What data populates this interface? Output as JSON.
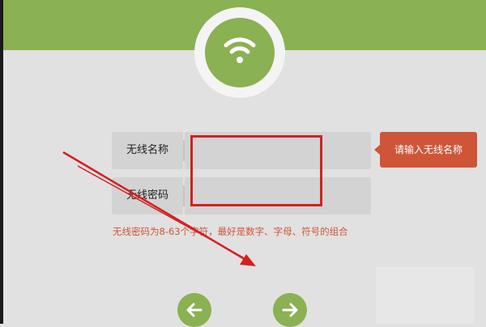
{
  "form": {
    "ssid_label": "无线名称",
    "ssid_value": "",
    "password_label": "无线密码",
    "password_value": ""
  },
  "tooltip": {
    "text": "请输入无线名称"
  },
  "hint": {
    "text": "无线密码为8-63个字符，最好是数字、字母、符号的组合"
  },
  "icons": {
    "logo": "wifi-icon",
    "prev": "arrow-left-icon",
    "next": "arrow-right-icon"
  },
  "colors": {
    "brand_green": "#8ab152",
    "error_red": "#cf5538",
    "annotation_red": "#d42020",
    "field_bg": "#d3d3d3",
    "page_bg": "#e1e1e1"
  }
}
